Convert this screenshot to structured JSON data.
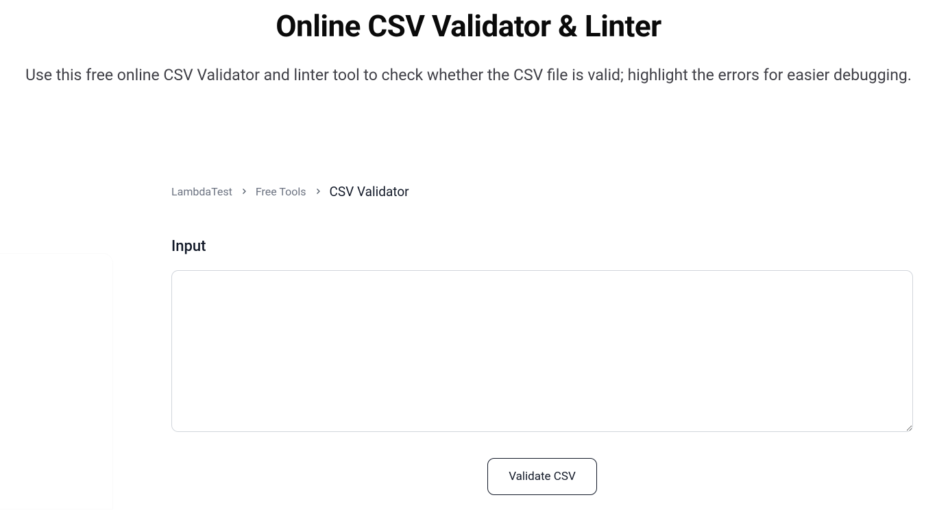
{
  "header": {
    "title": "Online CSV Validator & Linter",
    "subtitle": "Use this free online CSV Validator and linter tool to check whether the CSV file is valid; highlight the errors for easier debugging."
  },
  "breadcrumb": {
    "items": [
      {
        "label": "LambdaTest"
      },
      {
        "label": "Free Tools"
      }
    ],
    "current": "CSV Validator"
  },
  "form": {
    "input_label": "Input",
    "input_value": "",
    "validate_button": "Validate CSV"
  }
}
